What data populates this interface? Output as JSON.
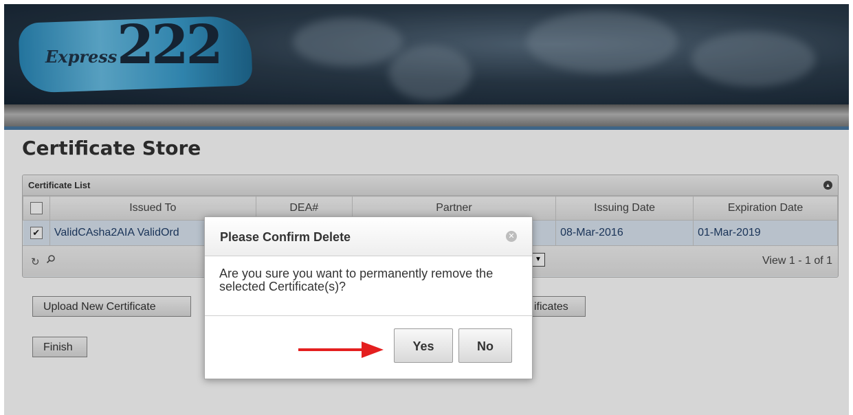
{
  "header": {
    "logo_word": "Express",
    "logo_number": "222"
  },
  "page": {
    "title": "Certificate Store"
  },
  "grid": {
    "caption": "Certificate List",
    "columns": [
      "Issued To",
      "DEA#",
      "Partner",
      "Issuing Date",
      "Expiration Date"
    ],
    "rows": [
      {
        "checked": true,
        "issued_to": "ValidCAsha2AIA ValidOrd",
        "dea": "",
        "partner": "",
        "issuing_date": "08-Mar-2016",
        "expiration_date": "01-Mar-2019"
      }
    ],
    "pager_text": "View 1 - 1 of 1"
  },
  "buttons": {
    "upload": "Upload New Certificate",
    "third_partial": "ificates",
    "finish": "Finish"
  },
  "dialog": {
    "title": "Please Confirm Delete",
    "message": "Are you sure you want to permanently remove the selected Certificate(s)?",
    "yes": "Yes",
    "no": "No"
  },
  "colors": {
    "accent": "#4a79a2",
    "arrow": "#e41f1f",
    "row_text": "#1f3e69"
  }
}
